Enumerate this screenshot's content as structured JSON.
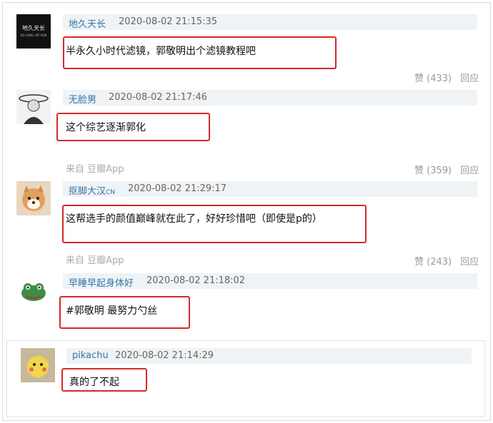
{
  "comments": [
    {
      "user": "地久天长",
      "time": "2020-08-02 21:15:35",
      "text": "半永久小时代滤镜，郭敬明出个滤镜教程吧",
      "like_label": "赞",
      "like_count": "(433)",
      "reply_label": "回应",
      "avatar_text": "地久天长",
      "avatar_sub": "SO LONG, MY SON"
    },
    {
      "user": "无脸男",
      "time": "2020-08-02 21:17:46",
      "text": "这个综艺逐渐郭化",
      "source": "来自 豆瓣App",
      "like_label": "赞",
      "like_count": "(359)",
      "reply_label": "回应"
    },
    {
      "user": "抠脚大汉",
      "user_badge": "CN",
      "time": "2020-08-02 21:29:17",
      "text": "这帮选手的颜值巅峰就在此了，好好珍惜吧（即使是p的）",
      "source": "来自 豆瓣App",
      "like_label": "赞",
      "like_count": "(243)",
      "reply_label": "回应"
    },
    {
      "user": "早睡早起身体好",
      "time": "2020-08-02 21:18:02",
      "text": "#郭敬明 最努力勺丝"
    },
    {
      "user": "pikachu",
      "time": "2020-08-02 21:14:29",
      "text": "真的了不起"
    }
  ]
}
